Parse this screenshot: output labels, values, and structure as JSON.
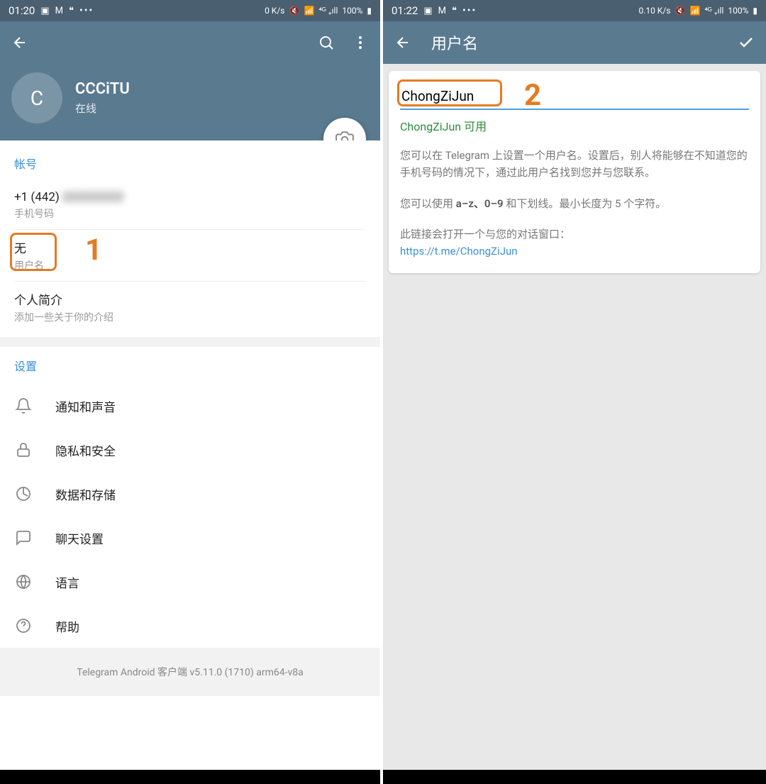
{
  "left": {
    "statusBar": {
      "time": "01:20",
      "speed": "0 K/s",
      "battery": "100%"
    },
    "profile": {
      "avatarLetter": "C",
      "name": "CCCiTU",
      "status": "在线"
    },
    "account": {
      "header": "帐号",
      "phone": {
        "value": "+1 (442)",
        "blurred": "222222222",
        "label": "手机号码"
      },
      "username": {
        "value": "无",
        "label": "用户名"
      },
      "bio": {
        "value": "个人简介",
        "label": "添加一些关于你的介绍"
      }
    },
    "annotations": {
      "num1": "1"
    },
    "settings": {
      "header": "设置",
      "items": [
        {
          "label": "通知和声音",
          "icon": "bell"
        },
        {
          "label": "隐私和安全",
          "icon": "lock"
        },
        {
          "label": "数据和存储",
          "icon": "data"
        },
        {
          "label": "聊天设置",
          "icon": "chat"
        },
        {
          "label": "语言",
          "icon": "globe"
        },
        {
          "label": "帮助",
          "icon": "help"
        }
      ]
    },
    "version": "Telegram Android 客户端 v5.11.0 (1710) arm64-v8a"
  },
  "right": {
    "statusBar": {
      "time": "01:22",
      "speed": "0.10 K/s",
      "battery": "100%"
    },
    "title": "用户名",
    "usernameInput": "ChongZiJun",
    "status": "ChongZiJun 可用",
    "desc1": "您可以在 Telegram 上设置一个用户名。设置后，别人将能够在不知道您的手机号码的情况下，通过此用户名找到您并与您联系。",
    "desc2a": "您可以使用 ",
    "desc2b": "a–z、0–9",
    "desc2c": " 和下划线。最小长度为 5 个字符。",
    "linkDesc": "此链接会打开一个与您的对话窗口：",
    "link": "https://t.me/ChongZiJun",
    "annotations": {
      "num2": "2"
    }
  }
}
